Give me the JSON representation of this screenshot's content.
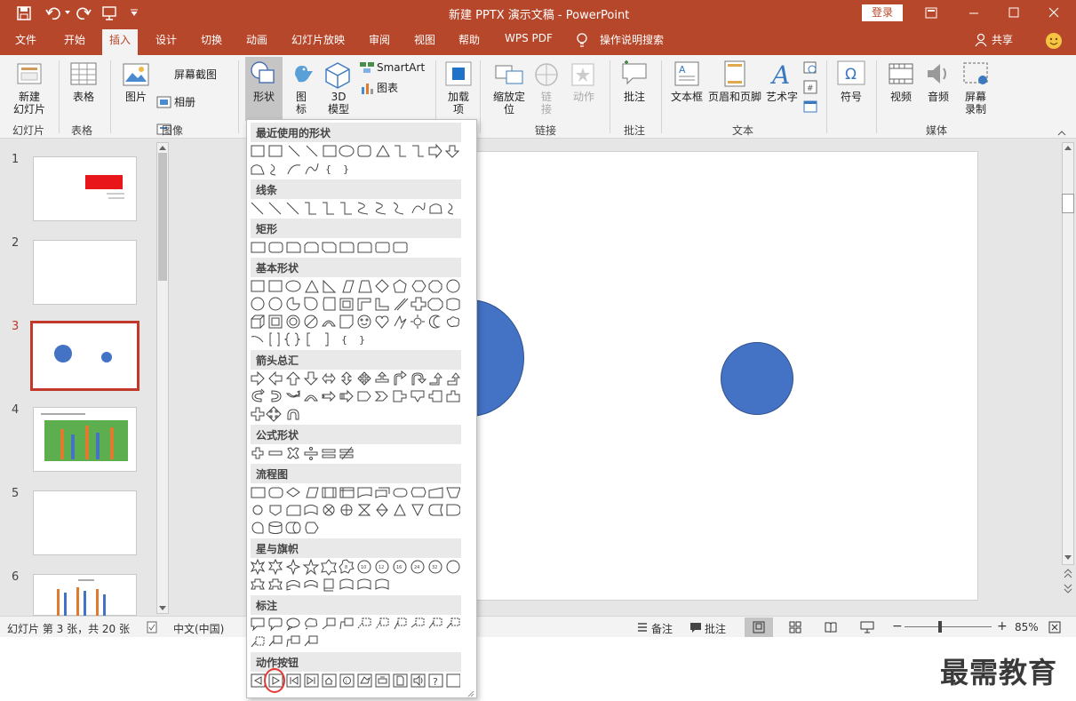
{
  "titlebar": {
    "title": "新建 PPTX 演示文稿 - PowerPoint",
    "login": "登录"
  },
  "tabs": [
    "文件",
    "开始",
    "插入",
    "设计",
    "切换",
    "动画",
    "幻灯片放映",
    "审阅",
    "视图",
    "帮助",
    "WPS PDF"
  ],
  "tell_me": "操作说明搜索",
  "share": "共享",
  "ribbon": {
    "new_slide": "新建\n幻灯片",
    "table": "表格",
    "picture": "图片",
    "screenshot": "屏幕截图",
    "album": "相册",
    "shapes": "形状",
    "icons": "图标",
    "model3d": "3D\n模型",
    "smartart": "SmartArt",
    "chart": "图表",
    "addins": "加载\n项",
    "zoom": "缩放定\n位",
    "link": "链\n接",
    "action": "动作",
    "comment": "批注",
    "textbox": "文本框",
    "header_footer": "页眉和页脚",
    "wordart": "艺术字",
    "symbol": "符号",
    "video": "视频",
    "audio": "音频",
    "screen_record": "屏幕\n录制",
    "groups": [
      "幻灯片",
      "表格",
      "图像",
      "链接",
      "批注",
      "文本",
      "媒体"
    ]
  },
  "slides": {
    "numbers": [
      "1",
      "2",
      "3",
      "4",
      "5",
      "6"
    ],
    "selected_index": 3
  },
  "gallery": {
    "sections": [
      "最近使用的形状",
      "线条",
      "矩形",
      "基本形状",
      "箭头总汇",
      "公式形状",
      "流程图",
      "星与旗帜",
      "标注",
      "动作按钮"
    ]
  },
  "status": {
    "slide_info": "幻灯片 第 3 张，共 20 张",
    "language": "中文(中国)",
    "notes": "备注",
    "comments": "批注",
    "zoom": "85%"
  },
  "watermark": "最需教育",
  "colors": {
    "accent": "#b7472a",
    "circle_fill": "#4472c4",
    "highlight_red": "#e8151b"
  }
}
